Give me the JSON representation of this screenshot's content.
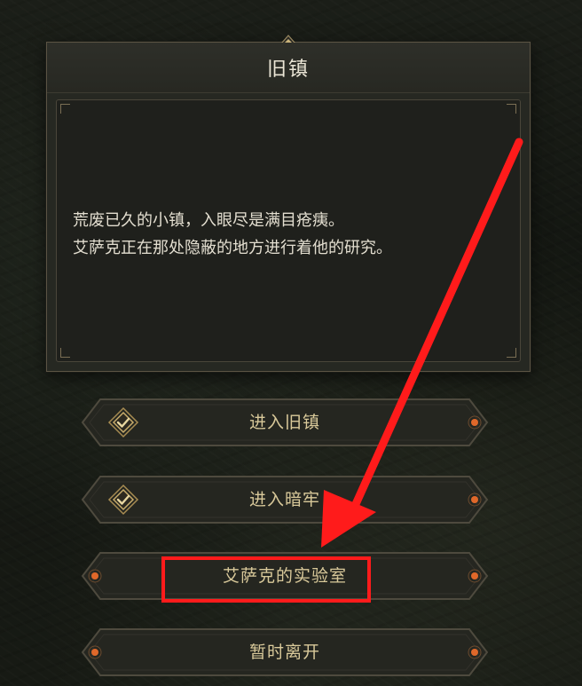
{
  "dialog": {
    "title": "旧镇",
    "description_lines": [
      "荒废已久的小镇，入眼尽是满目疮痍。",
      "艾萨克正在那处隐蔽的地方进行着他的研究。"
    ]
  },
  "options": [
    {
      "label": "进入旧镇",
      "icon": "check-diamond-icon",
      "completed": true
    },
    {
      "label": "进入暗牢",
      "icon": "check-diamond-icon",
      "completed": true
    },
    {
      "label": "艾萨克的实验室",
      "completed": false,
      "highlighted": true
    },
    {
      "label": "暂时离开",
      "completed": false
    }
  ],
  "colors": {
    "annotation": "#ff1b1b",
    "option_text": "#d9c99a",
    "panel_bg": "#262822",
    "accent_gold": "#b89a5a",
    "gem_orange": "#e0682a"
  }
}
